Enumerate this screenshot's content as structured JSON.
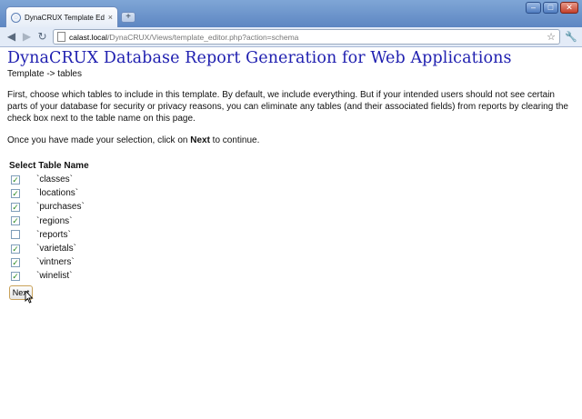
{
  "browser": {
    "tab_title": "DynaCRUX Template Editor",
    "tab_close": "×",
    "new_tab": "+",
    "favicon": "globe-icon",
    "url_host": "calast.local",
    "url_path": "/DynaCRUX/Views/template_editor.php?action=schema",
    "icons": {
      "back": "◀",
      "forward": "▶",
      "reload": "↻",
      "star": "☆",
      "wrench": "🔧"
    },
    "window_controls": {
      "minimize": "–",
      "maximize": "□",
      "close": "✕"
    }
  },
  "page": {
    "title": "DynaCRUX Database Report Generation for Web Applications",
    "breadcrumb": "Template -> tables",
    "intro": "First, choose which tables to include in this template. By default, we include everything. But if your intended users should not see certain parts of your database for security or privacy reasons, you can eliminate any tables (and their associated fields) from reports by clearing the check box next to the table name on this page.",
    "continue_prefix": "Once you have made your selection, click on ",
    "continue_bold": "Next",
    "continue_suffix": " to continue.",
    "list_header": "Select Table Name",
    "check_mark": "✓",
    "tables": [
      {
        "name": "`classes`",
        "checked": true
      },
      {
        "name": "`locations`",
        "checked": true
      },
      {
        "name": "`purchases`",
        "checked": true
      },
      {
        "name": "`regions`",
        "checked": true
      },
      {
        "name": "`reports`",
        "checked": false
      },
      {
        "name": "`varietals`",
        "checked": true
      },
      {
        "name": "`vintners`",
        "checked": true
      },
      {
        "name": "`winelist`",
        "checked": true
      }
    ],
    "next_label": "Next"
  },
  "colors": {
    "title": "#2020b0",
    "chrome": "#6d94cc",
    "check": "#2b8a22"
  }
}
